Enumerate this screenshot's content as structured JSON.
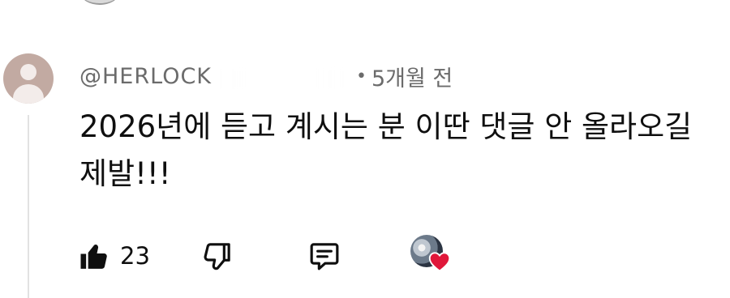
{
  "comment": {
    "author_handle": "@HERLOCK",
    "separator": "•",
    "time": "5개월 전",
    "text": "2026년에 듣고 계시는 분 이딴 댓글 안 올라오길 제발!!!"
  },
  "actions": {
    "like_count": "23",
    "creator_heart_color": "#e0173a"
  },
  "icons": {
    "avatar": "default-user-avatar-icon",
    "like": "thumbs-up-filled-icon",
    "dislike": "thumbs-down-outline-icon",
    "reply": "comment-reply-icon",
    "creator_heart": "creator-heart-icon"
  }
}
